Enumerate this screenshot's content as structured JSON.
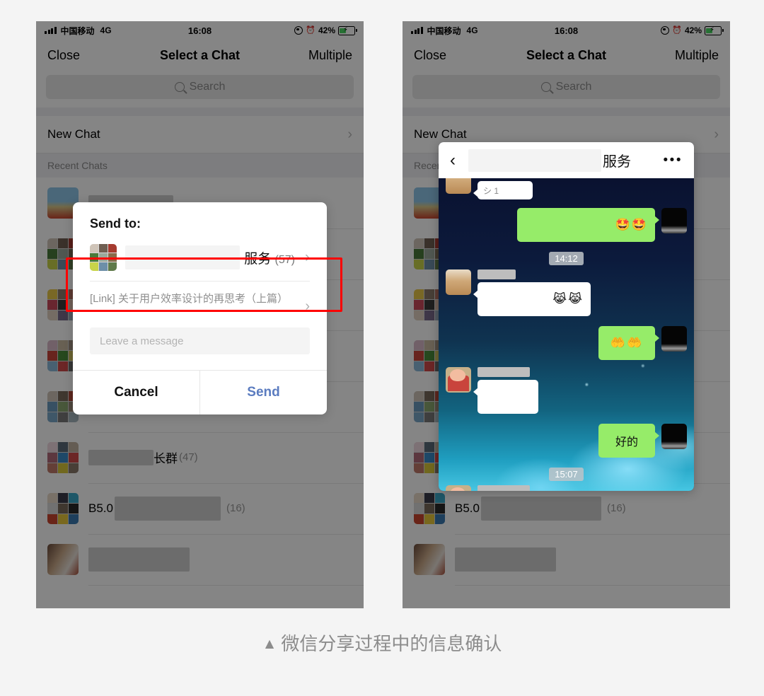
{
  "page": {
    "background": "#f4f4f4",
    "caption": "微信分享过程中的信息确认",
    "caption_marker": "▲"
  },
  "status_bar": {
    "carrier": "中国移动",
    "network": "4G",
    "time": "16:08",
    "battery_percent": "42%",
    "battery_level": 42,
    "charging": true,
    "icons": [
      "signal-icon",
      "location-icon",
      "alarm-icon",
      "battery-icon"
    ]
  },
  "nav_bar": {
    "left_button": "Close",
    "title": "Select a Chat",
    "right_button": "Multiple"
  },
  "search": {
    "placeholder": "Search"
  },
  "list": {
    "new_chat": "New Chat",
    "section_header": "Recent Chats",
    "rows": [
      {
        "name": "",
        "count": "",
        "avatar": "windmill-photo",
        "redacted": true
      },
      {
        "name": "",
        "count": "",
        "avatar": "grid-9-a",
        "redacted": true
      },
      {
        "name": "",
        "count": "",
        "avatar": "grid-9-b",
        "redacted": true
      },
      {
        "name": "",
        "count": "",
        "avatar": "grid-9-c",
        "redacted": true
      },
      {
        "name": "",
        "count": "",
        "avatar": "grid-9-d",
        "redacted": true
      },
      {
        "name": "长群",
        "count": "(47)",
        "avatar": "grid-9-e",
        "redacted": true
      },
      {
        "name": "B5.0",
        "count": "(16)",
        "avatar": "grid-9-f",
        "redacted": true
      },
      {
        "name": "",
        "count": "",
        "avatar": "child-photo",
        "redacted": true
      }
    ]
  },
  "modal": {
    "title": "Send to:",
    "target": {
      "name": "服务",
      "count": "(57)",
      "avatar": "grid-9-service",
      "highlight_color": "#ff0000"
    },
    "link_text": "[Link] 关于用户效率设计的再思考（上篇）",
    "message_placeholder": "Leave a message",
    "cancel_label": "Cancel",
    "send_label": "Send",
    "send_color": "#5b7cc0"
  },
  "chat_panel": {
    "back_icon": "chevron-left-icon",
    "title": "服务",
    "menu_icon": "more-dots-icon",
    "bubble_green": "#96ec69",
    "messages": [
      {
        "side": "in",
        "type": "partial",
        "text": "",
        "avatar": "cat-avatar"
      },
      {
        "side": "out",
        "type": "emoji",
        "text": "🤩🤩",
        "avatar": "me-avatar"
      },
      {
        "side": "time",
        "type": "time",
        "text": "14:12"
      },
      {
        "side": "in",
        "type": "emoji",
        "text": "😹😹",
        "avatar": "cat-avatar"
      },
      {
        "side": "out",
        "type": "emoji",
        "text": "🤲🤲",
        "avatar": "me-avatar"
      },
      {
        "side": "in",
        "type": "blank",
        "text": "",
        "avatar": "shin-avatar"
      },
      {
        "side": "out",
        "type": "text",
        "text": "好的",
        "avatar": "me-avatar"
      },
      {
        "side": "time",
        "type": "time",
        "text": "15:07"
      },
      {
        "side": "in",
        "type": "blank",
        "text": "",
        "avatar": "shin-avatar"
      }
    ]
  }
}
